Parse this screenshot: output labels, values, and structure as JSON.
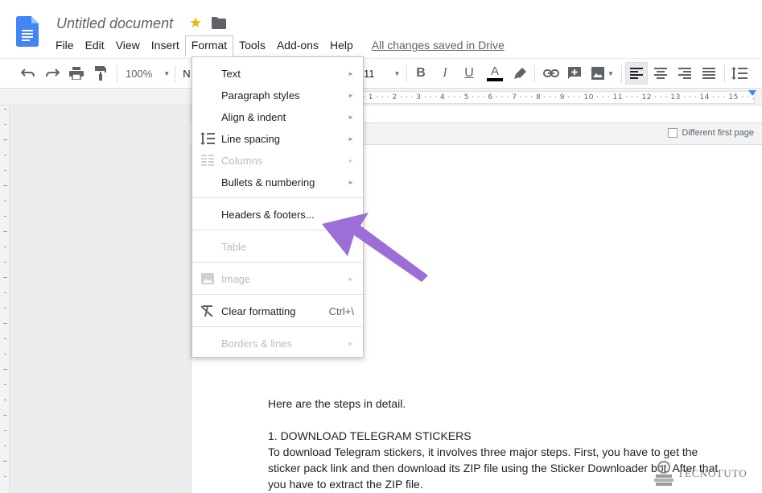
{
  "document": {
    "title": "Untitled document",
    "saved_status": "All changes saved in Drive"
  },
  "menubar": [
    "File",
    "Edit",
    "View",
    "Insert",
    "Format",
    "Tools",
    "Add-ons",
    "Help"
  ],
  "toolbar": {
    "zoom": "100%",
    "style_partial": "N",
    "font_size_partial": "11"
  },
  "ruler": {
    "ticks": "· 1 · · · 2 · · · 3 · · · 4 · · · 5 · · · 6 · · · 7 · · · 8 · · · 9 · · · 10 · · · 11 · · · 12 · · · 13 · · · 14 · · · 15 · · 16"
  },
  "header_options": {
    "different_first_page": "Different first page"
  },
  "format_menu": {
    "text": "Text",
    "paragraph_styles": "Paragraph styles",
    "align_indent": "Align & indent",
    "line_spacing": "Line spacing",
    "columns": "Columns",
    "bullets": "Bullets & numbering",
    "headers_footers": "Headers & footers...",
    "table": "Table",
    "image": "Image",
    "clear_formatting": "Clear formatting",
    "clear_formatting_shortcut": "Ctrl+\\",
    "borders_lines": "Borders & lines"
  },
  "content": {
    "intro": "Here are the steps in detail.",
    "heading": "1. DOWNLOAD TELEGRAM STICKERS",
    "line1": "To download Telegram stickers, it involves three major steps. First, you have to get the",
    "line2": "sticker pack link and then download its ZIP file using the Sticker Downloader bot. After that,",
    "line3": "you have to extract the ZIP file."
  },
  "watermark": "TECNOTUTO",
  "colors": {
    "arrow": "#9b6fd6",
    "star": "#f4b400",
    "docs_blue": "#4285f4"
  }
}
